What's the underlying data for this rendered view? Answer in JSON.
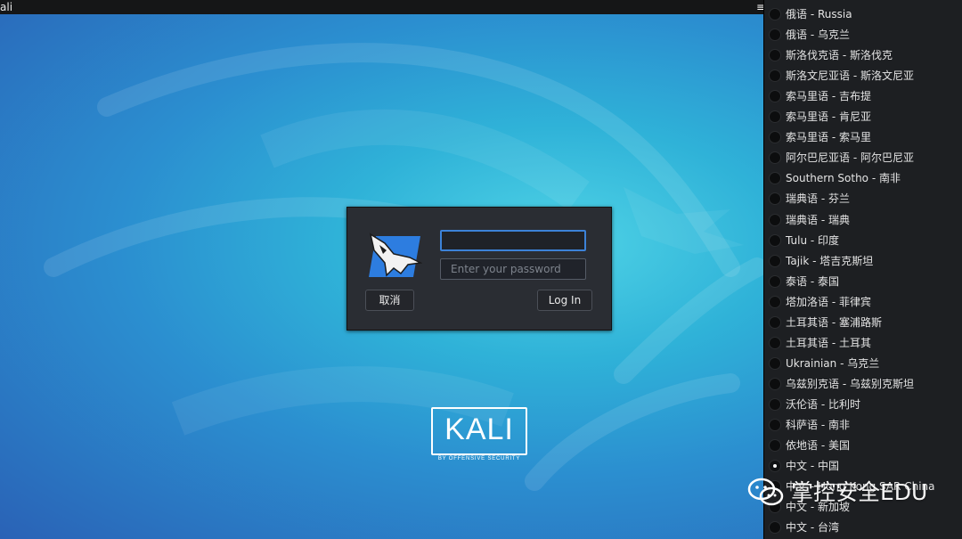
{
  "topbar": {
    "title": "ali",
    "menu_icon": "hamburger-icon"
  },
  "login": {
    "username_value": "",
    "password_placeholder": "Enter your password",
    "cancel_label": "取消",
    "login_label": "Log In"
  },
  "brand": {
    "name": "KALI",
    "tagline": "BY OFFENSIVE SECURITY"
  },
  "languages": {
    "selected_index": 22,
    "items": [
      "俄语 - Russia",
      "俄语 - 乌克兰",
      "斯洛伐克语 - 斯洛伐克",
      "斯洛文尼亚语 - 斯洛文尼亚",
      "索马里语 - 吉布提",
      "索马里语 - 肯尼亚",
      "索马里语 - 索马里",
      "阿尔巴尼亚语 - 阿尔巴尼亚",
      "Southern Sotho - 南非",
      "瑞典语 - 芬兰",
      "瑞典语 - 瑞典",
      "Tulu - 印度",
      "Tajik - 塔吉克斯坦",
      "泰语 - 泰国",
      "塔加洛语 - 菲律宾",
      "土耳其语 - 塞浦路斯",
      "土耳其语 - 土耳其",
      "Ukrainian - 乌克兰",
      "乌兹别克语 - 乌兹别克斯坦",
      "沃伦语 - 比利时",
      "科萨语 - 南非",
      "依地语 - 美国",
      "中文 - 中国",
      "中文 - Hong Kong SAR China",
      "中文 - 新加坡",
      "中文 - 台湾"
    ]
  },
  "watermark": {
    "text": "掌控安全EDU",
    "icon": "wechat-icon"
  }
}
